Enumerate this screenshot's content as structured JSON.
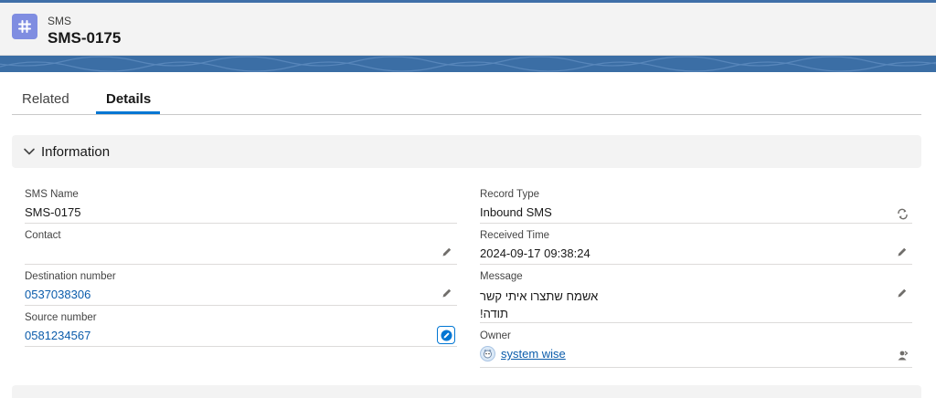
{
  "header": {
    "object_type": "SMS",
    "record_name": "SMS-0175",
    "icon": "hash-icon"
  },
  "tabs": [
    {
      "label": "Related",
      "active": false
    },
    {
      "label": "Details",
      "active": true
    }
  ],
  "section": {
    "title": "Information",
    "expanded": true
  },
  "fields": {
    "sms_name": {
      "label": "SMS Name",
      "value": "SMS-0175"
    },
    "contact": {
      "label": "Contact",
      "value": ""
    },
    "destination_number": {
      "label": "Destination number",
      "value": "0537038306"
    },
    "source_number": {
      "label": "Source number",
      "value": "0581234567"
    },
    "record_type": {
      "label": "Record Type",
      "value": "Inbound SMS"
    },
    "received_time": {
      "label": "Received Time",
      "value": "2024-09-17 09:38:24"
    },
    "message": {
      "label": "Message",
      "line1": "אשמח שתצרו איתי קשר",
      "line2": "תודה!"
    },
    "owner": {
      "label": "Owner",
      "value": "system wise"
    }
  },
  "colors": {
    "accent": "#0176d3",
    "link": "#0b5cab",
    "object_icon": "#7f8de1",
    "banner": "#3b6ea5"
  }
}
